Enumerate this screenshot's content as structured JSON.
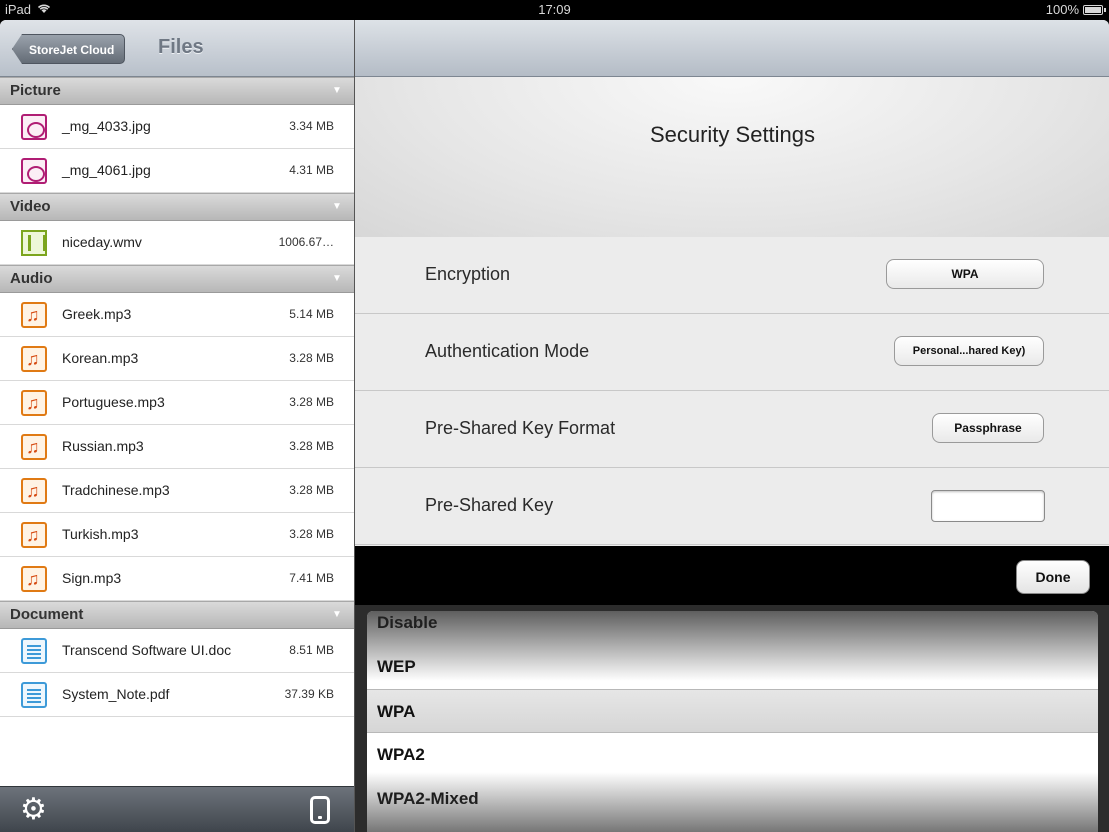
{
  "status_bar": {
    "device": "iPad",
    "time": "17:09",
    "battery": "100%"
  },
  "left_nav": {
    "back_label": "StoreJet Cloud",
    "title": "Files"
  },
  "sections": [
    {
      "title": "Picture",
      "items": [
        {
          "name": "_mg_4033.jpg",
          "size": "3.34 MB",
          "icon": "picture-icon"
        },
        {
          "name": "_mg_4061.jpg",
          "size": "4.31 MB",
          "icon": "picture-icon"
        }
      ]
    },
    {
      "title": "Video",
      "items": [
        {
          "name": "niceday.wmv",
          "size": "1006.67…",
          "icon": "video-icon"
        }
      ]
    },
    {
      "title": "Audio",
      "items": [
        {
          "name": "Greek.mp3",
          "size": "5.14 MB",
          "icon": "audio-icon"
        },
        {
          "name": "Korean.mp3",
          "size": "3.28 MB",
          "icon": "audio-icon"
        },
        {
          "name": "Portuguese.mp3",
          "size": "3.28 MB",
          "icon": "audio-icon"
        },
        {
          "name": "Russian.mp3",
          "size": "3.28 MB",
          "icon": "audio-icon"
        },
        {
          "name": "Tradchinese.mp3",
          "size": "3.28 MB",
          "icon": "audio-icon"
        },
        {
          "name": "Turkish.mp3",
          "size": "3.28 MB",
          "icon": "audio-icon"
        },
        {
          "name": "Sign.mp3",
          "size": "7.41 MB",
          "icon": "audio-icon"
        }
      ]
    },
    {
      "title": "Document",
      "items": [
        {
          "name": "Transcend Software UI.doc",
          "size": "8.51 MB",
          "icon": "document-icon"
        },
        {
          "name": "System_Note.pdf",
          "size": "37.39 KB",
          "icon": "document-icon"
        }
      ]
    }
  ],
  "toolbar": {
    "left_icon": "gear-icon",
    "right_icon": "device-icon"
  },
  "settings": {
    "title": "Security Settings",
    "encryption": {
      "label": "Encryption",
      "value": "WPA"
    },
    "auth_mode": {
      "label": "Authentication Mode",
      "value": "Personal...hared Key)"
    },
    "psk_format": {
      "label": "Pre-Shared Key Format",
      "value": "Passphrase"
    },
    "psk": {
      "label": "Pre-Shared Key",
      "value": ""
    }
  },
  "picker": {
    "done_label": "Done",
    "options": [
      "Disable",
      "WEP",
      "WPA",
      "WPA2",
      "WPA2-Mixed"
    ],
    "selected": "WPA"
  }
}
